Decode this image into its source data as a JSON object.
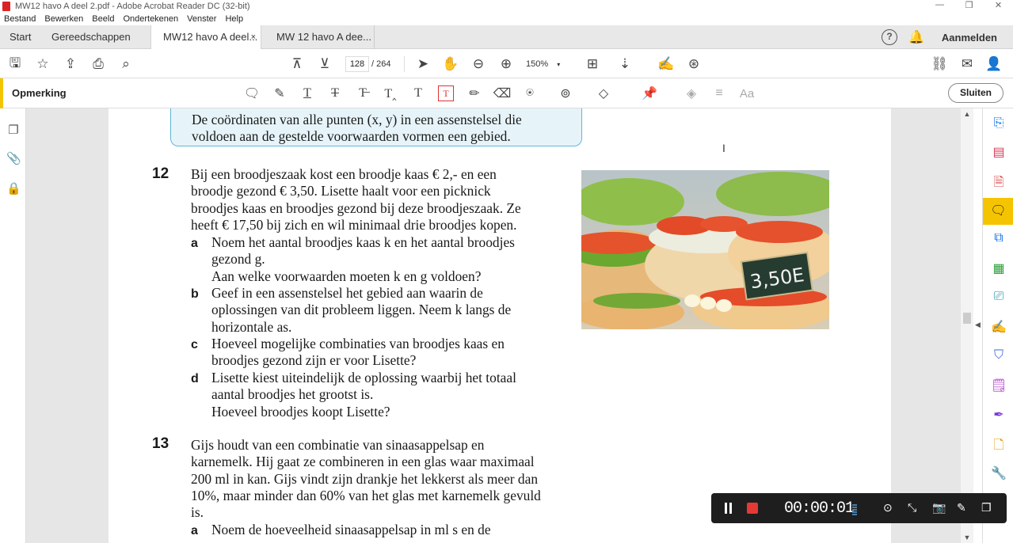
{
  "window": {
    "title": "MW12 havo A deel 2.pdf - Adobe Acrobat Reader DC (32-bit)",
    "controls": [
      "—",
      "❐",
      "✕"
    ]
  },
  "menu": [
    "Bestand",
    "Bewerken",
    "Beeld",
    "Ondertekenen",
    "Venster",
    "Help"
  ],
  "tabs": {
    "home": "Start",
    "tools": "Gereedschappen",
    "doc1": "MW12 havo A deel...",
    "doc1_close": "×",
    "doc2": "MW 12 havo A dee...",
    "signin": "Aanmelden"
  },
  "toolbar": {
    "page_current": "128",
    "page_total": "/ 264",
    "zoom": "150%"
  },
  "comment_bar": {
    "title": "Opmerking",
    "close": "Sluiten"
  },
  "document": {
    "infobox": {
      "line1": "De coördinaten van alle punten (x, y) in een assenstelsel die",
      "line2": "voldoen aan de gestelde voorwaarden vormen een gebied."
    },
    "q12": {
      "number": "12",
      "intro": [
        "Bij een broodjeszaak kost een broodje kaas € 2,- en een",
        "broodje gezond € 3,50. Lisette haalt voor een picknick",
        "broodjes kaas en broodjes gezond bij deze broodjeszaak. Ze",
        "heeft € 17,50 bij zich en wil minimaal drie broodjes kopen."
      ],
      "a_label": "a",
      "a": [
        "Noem het aantal broodjes kaas k en het aantal broodjes",
        "gezond g.",
        "Aan welke voorwaarden moeten k en g voldoen?"
      ],
      "b_label": "b",
      "b": [
        "Geef in een assenstelsel het gebied aan waarin de",
        "oplossingen van dit probleem liggen. Neem k langs de",
        "horizontale as."
      ],
      "c_label": "c",
      "c": [
        "Hoeveel mogelijke combinaties van broodjes kaas en",
        "broodjes gezond zijn er voor Lisette?"
      ],
      "d_label": "d",
      "d": [
        "Lisette kiest uiteindelijk de oplossing waarbij het totaal",
        "aantal broodjes het grootst is.",
        "Hoeveel broodjes koopt Lisette?"
      ],
      "price_tag": "3,50E"
    },
    "q13": {
      "number": "13",
      "intro": [
        "Gijs houdt van een combinatie van sinaasappelsap en",
        "karnemelk. Hij gaat ze combineren in een glas waar maximaal",
        "200 ml in kan. Gijs vindt zijn drankje het lekkerst als meer dan",
        "10%, maar minder dan 60% van het glas met karnemelk gevuld",
        "is."
      ],
      "a_label": "a",
      "a": [
        "Noem de hoeveelheid sinaasappelsap in ml s en de"
      ]
    }
  },
  "recorder": {
    "timer": "00:00:01"
  }
}
